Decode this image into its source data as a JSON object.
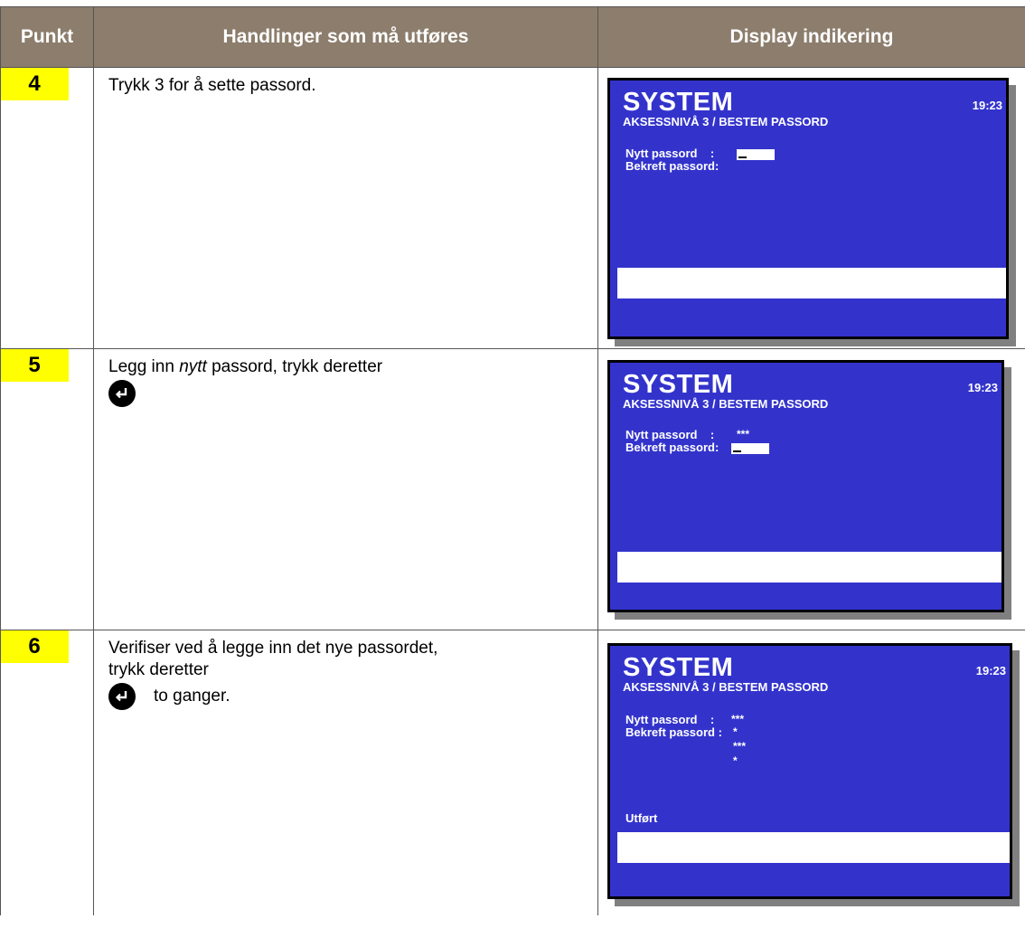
{
  "header": {
    "col_punkt": "Punkt",
    "col_actions": "Handlinger som må utføres",
    "col_display": "Display indikering"
  },
  "steps": [
    {
      "punkt": "4",
      "action": "Trykk 3 for å sette passord.",
      "display": {
        "title": "SYSTEM",
        "time": "19:23",
        "subtitle": "AKSESSNIVÅ 3 / BESTEM PASSORD",
        "label_1": "Nytt passord    :",
        "label_2": "Bekreft passord:"
      }
    },
    {
      "punkt": "5",
      "action_prefix": "Legg inn ",
      "action_emph": "nytt",
      "action_suffix": " passord, trykk deretter",
      "enter_icon": "enter-key-icon",
      "display": {
        "title": "SYSTEM",
        "time": "19:23",
        "subtitle": "AKSESSNIVÅ 3 / BESTEM PASSORD",
        "label_1": "Nytt passord    :",
        "value_1": "***",
        "label_2": "Bekreft passord:"
      }
    },
    {
      "punkt": "6",
      "action_line1": "Verifiser ved å legge inn det nye passordet,",
      "action_line2": "trykk deretter",
      "action_after_icon": "to ganger.",
      "enter_icon": "enter-key-icon",
      "display": {
        "title": "SYSTEM",
        "time": "19:23",
        "subtitle": "AKSESSNIVÅ 3 / BESTEM PASSORD",
        "label_1": "Nytt passord    :",
        "value_1": "***",
        "label_2": "Bekreft passord :",
        "value_2": "*",
        "value_3": "***",
        "value_4": "*",
        "status": "Utført"
      }
    }
  ],
  "colors": {
    "header_bg": "#8c7d6c",
    "badge_bg": "#ffff00",
    "lcd_bg": "#3333cc"
  }
}
